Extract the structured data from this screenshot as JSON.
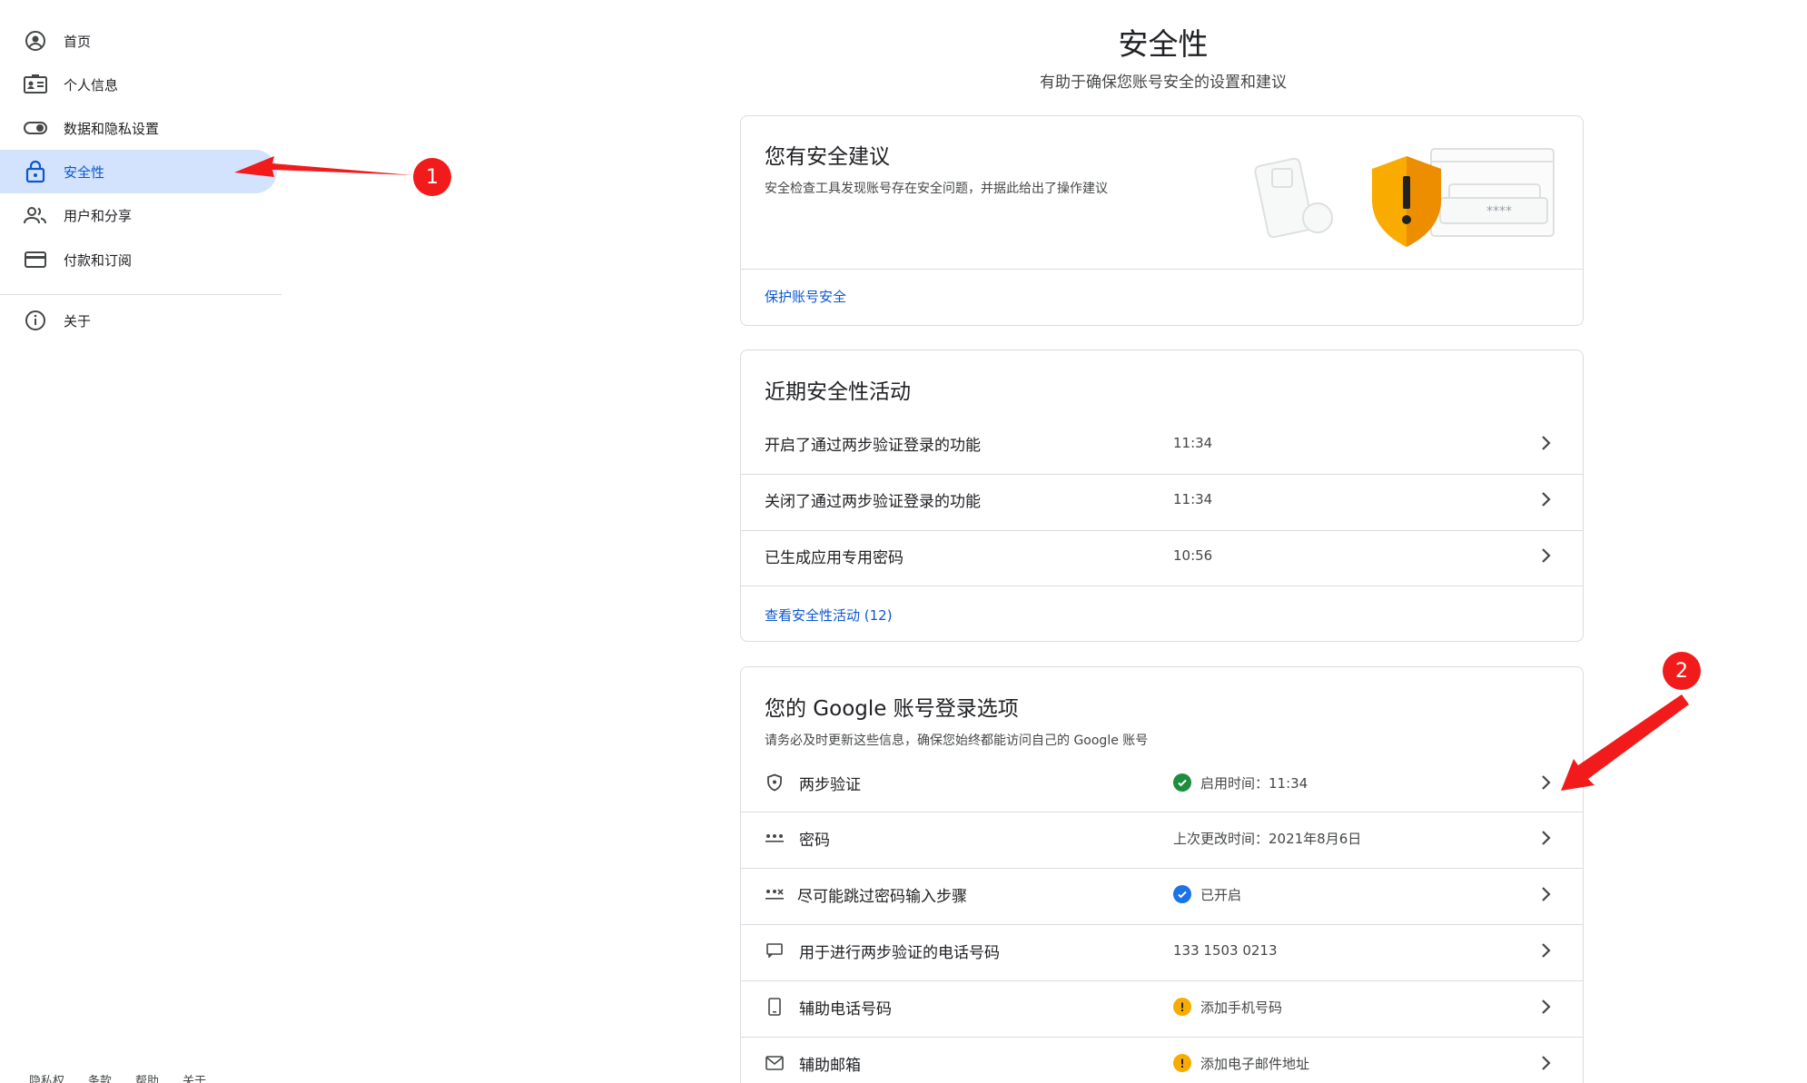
{
  "sidebar": {
    "items": [
      {
        "label": "首页",
        "icon": "account-circle-icon"
      },
      {
        "label": "个人信息",
        "icon": "id-card-icon"
      },
      {
        "label": "数据和隐私设置",
        "icon": "toggle-icon"
      },
      {
        "label": "安全性",
        "icon": "lock-icon",
        "active": true
      },
      {
        "label": "用户和分享",
        "icon": "people-icon"
      },
      {
        "label": "付款和订阅",
        "icon": "credit-card-icon"
      }
    ],
    "about": {
      "label": "关于",
      "icon": "info-icon"
    }
  },
  "footer": {
    "links": [
      "隐私权",
      "条款",
      "帮助",
      "关于"
    ]
  },
  "header": {
    "title": "安全性",
    "subtitle": "有助于确保您账号安全的设置和建议"
  },
  "recommendation_card": {
    "title": "您有安全建议",
    "description": "安全检查工具发现账号存在安全问题，并据此给出了操作建议",
    "link": "保护账号安全",
    "illustration_password": "****"
  },
  "activity_card": {
    "title": "近期安全性活动",
    "rows": [
      {
        "label": "开启了通过两步验证登录的功能",
        "time": "11:34"
      },
      {
        "label": "关闭了通过两步验证登录的功能",
        "time": "11:34"
      },
      {
        "label": "已生成应用专用密码",
        "time": "10:56"
      }
    ],
    "link": "查看安全性活动 (12)"
  },
  "signin_card": {
    "title": "您的 Google 账号登录选项",
    "description": "请务必及时更新这些信息，确保您始终都能访问自己的 Google 账号",
    "rows": [
      {
        "label": "两步验证",
        "icon": "shield-icon",
        "value": "启用时间：11:34",
        "status": "ok"
      },
      {
        "label": "密码",
        "icon": "password-dots-icon",
        "value": "上次更改时间：2021年8月6日",
        "status": "none"
      },
      {
        "label": "尽可能跳过密码输入步骤",
        "icon": "passkey-icon",
        "value": "已开启",
        "status": "on"
      },
      {
        "label": "用于进行两步验证的电话号码",
        "icon": "message-icon",
        "value": "133 1503 0213",
        "status": "none"
      },
      {
        "label": "辅助电话号码",
        "icon": "phone-icon",
        "value": "添加手机号码",
        "status": "warn"
      },
      {
        "label": "辅助邮箱",
        "icon": "mail-icon",
        "value": "添加电子邮件地址",
        "status": "warn"
      }
    ]
  },
  "annotations": {
    "badge1": "1",
    "badge2": "2"
  },
  "colors": {
    "accent": "#0b57d0",
    "active_bg": "#d3e3fd",
    "ok_green": "#1e8e3e",
    "info_blue": "#1a73e8",
    "warn_yellow": "#f9ab00",
    "annotation_red": "#f21b1b"
  }
}
